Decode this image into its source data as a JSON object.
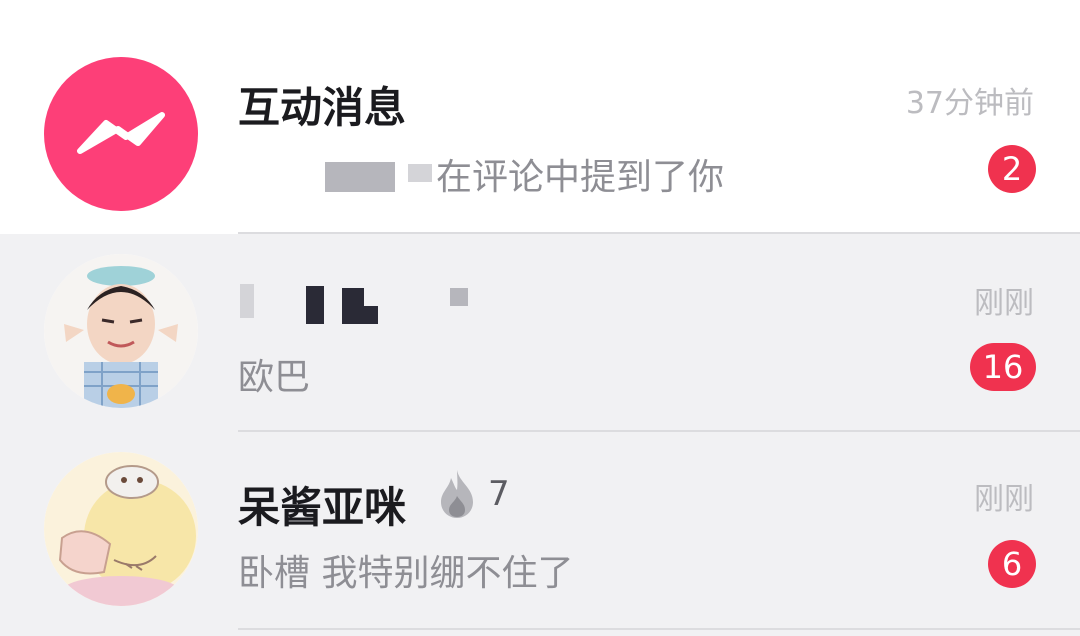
{
  "rows": [
    {
      "title": "互动消息",
      "subtitle": "在评论中提到了你",
      "time": "37分钟前",
      "badge": "2",
      "avatar_icon": "interaction-icon",
      "colors": {
        "avatar_bg": "#fd3f78",
        "badge_bg": "#f0324f"
      }
    },
    {
      "title": "",
      "subtitle": "欧巴",
      "time": "刚刚",
      "badge": "16",
      "avatar_icon": "user-avatar-photo"
    },
    {
      "title": "呆酱亚咪",
      "subtitle": "卧槽 我特别绷不住了",
      "time": "刚刚",
      "badge": "6",
      "streak": "7",
      "streak_icon": "flame-icon",
      "avatar_icon": "user-avatar-illustration"
    }
  ]
}
